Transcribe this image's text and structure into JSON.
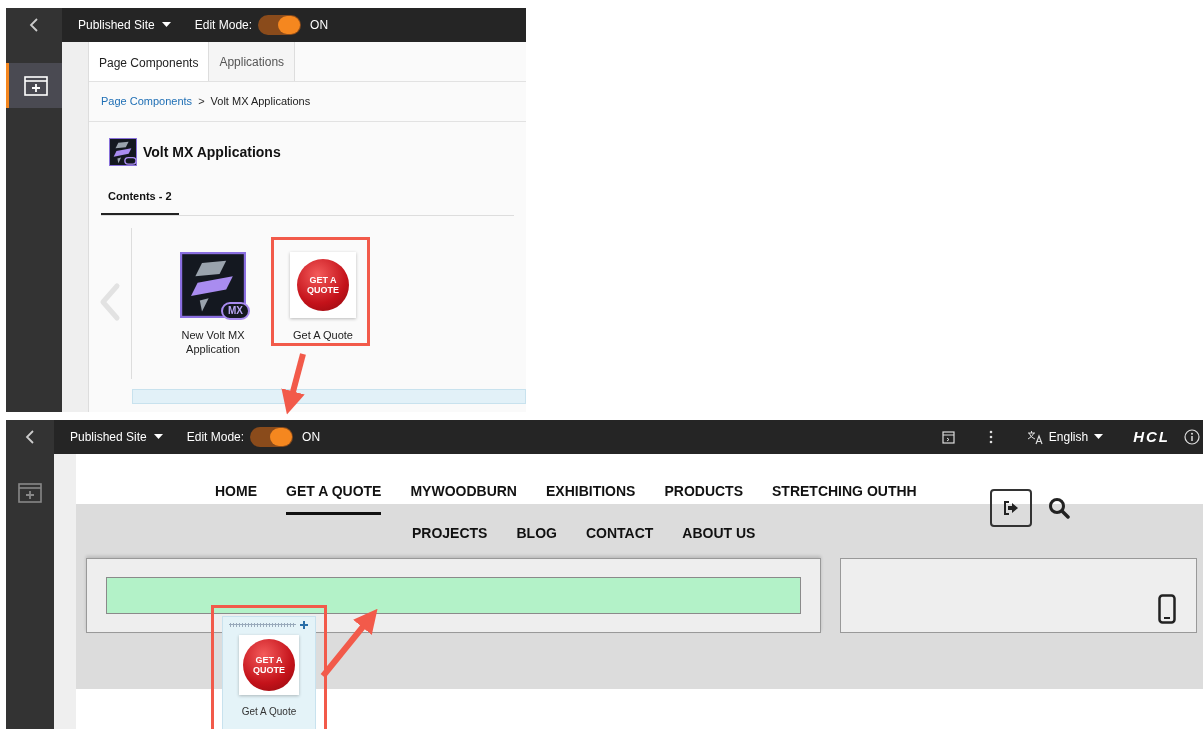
{
  "panel_view": {
    "topbar": {
      "site_menu": "Published Site",
      "edit_mode_label": "Edit Mode:",
      "edit_mode": {
        "on": true,
        "label": "ON"
      }
    },
    "tabs": [
      {
        "label": "Page Components",
        "selected": true
      },
      {
        "label": "Applications",
        "selected": false
      }
    ],
    "breadcrumb": [
      {
        "label": "Page Components",
        "kind": "link"
      },
      {
        "label": "Volt MX Applications",
        "kind": "current"
      }
    ],
    "breadcrumb_separator": ">",
    "heading": "Volt MX Applications",
    "content_tabs": [
      {
        "label": "Contents - 2",
        "selected": true
      }
    ],
    "items": [
      {
        "kind": "volt",
        "label": "New Volt MX Application",
        "badge": "MX",
        "highlighted": false
      },
      {
        "kind": "quote",
        "label": "Get A Quote",
        "thumb_text": "GET A QUOTE",
        "highlighted": true
      }
    ]
  },
  "page_view": {
    "topbar": {
      "site_menu": "Published Site",
      "edit_mode_label": "Edit Mode:",
      "edit_mode": {
        "on": true,
        "label": "ON"
      },
      "language": "English",
      "brand": "HCL"
    },
    "nav_rows": [
      [
        {
          "label": "HOME",
          "selected": false
        },
        {
          "label": "GET A QUOTE",
          "selected": true
        },
        {
          "label": "MYWOODBURN",
          "selected": false
        },
        {
          "label": "EXHIBITIONS",
          "selected": false
        },
        {
          "label": "PRODUCTS",
          "selected": false
        },
        {
          "label": "STRETCHING OUTHH",
          "selected": false
        }
      ],
      [
        {
          "label": "PROJECTS",
          "selected": false
        },
        {
          "label": "BLOG",
          "selected": false
        },
        {
          "label": "CONTACT",
          "selected": false
        },
        {
          "label": "ABOUT US",
          "selected": false
        }
      ]
    ],
    "drag_item": {
      "label": "Get A Quote",
      "thumb_text": "GET A QUOTE",
      "highlighted": true
    }
  }
}
